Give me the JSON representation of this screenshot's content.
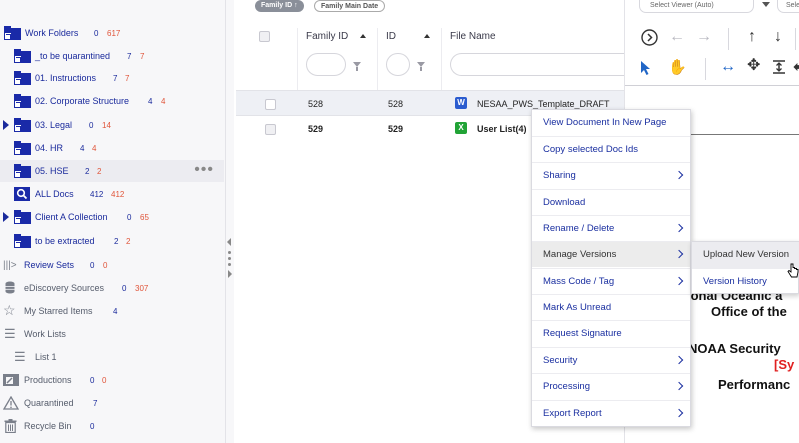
{
  "sidebar": {
    "items": [
      {
        "label": "Work Folders",
        "count_blue": "0",
        "count_red": "617"
      },
      {
        "label": "_to be quarantined",
        "count_blue": "7",
        "count_red": "7"
      },
      {
        "label": "01. Instructions",
        "count_blue": "7",
        "count_red": "7"
      },
      {
        "label": "02. Corporate Structure",
        "count_blue": "4",
        "count_red": "4"
      },
      {
        "label": "03. Legal",
        "count_blue": "0",
        "count_red": "14"
      },
      {
        "label": "04. HR",
        "count_blue": "4",
        "count_red": "4"
      },
      {
        "label": "05. HSE",
        "count_blue": "2",
        "count_red": "2"
      },
      {
        "label": "ALL Docs",
        "count_blue": "412",
        "count_red": "412"
      },
      {
        "label": "Client A Collection",
        "count_blue": "0",
        "count_red": "65"
      },
      {
        "label": "to be extracted",
        "count_blue": "2",
        "count_red": "2"
      }
    ],
    "sections": [
      {
        "label": "Review Sets",
        "count_blue": "0",
        "count_red": "0",
        "icon": "review-sets-icon"
      },
      {
        "label": "eDiscovery Sources",
        "count_blue": "0",
        "count_red": "307",
        "icon": "database-icon"
      },
      {
        "label": "My Starred Items",
        "count_blue": "4",
        "icon": "star-icon"
      },
      {
        "label": "Work Lists",
        "icon": "list-icon"
      },
      {
        "label": "List 1",
        "icon": "list-icon"
      },
      {
        "label": "Productions",
        "count_blue": "0",
        "count_red": "0",
        "icon": "productions-icon"
      },
      {
        "label": "Quarantined",
        "count_blue": "7",
        "icon": "warning-icon"
      },
      {
        "label": "Recycle Bin",
        "count_blue": "0",
        "icon": "trash-icon"
      }
    ]
  },
  "grid": {
    "sort_chips": [
      "Family ID ↑",
      "Family Main Date"
    ],
    "columns": [
      "Family ID",
      "ID",
      "File Name"
    ],
    "rows": [
      {
        "family_id": "528",
        "id": "528",
        "file_icon": "W",
        "file_name": "NESAA_PWS_Template_DRAFT"
      },
      {
        "family_id": "529",
        "id": "529",
        "file_icon": "X",
        "file_name": "User List(4)"
      }
    ]
  },
  "viewer": {
    "select_viewer": "Select Viewer (Auto)",
    "select_right": "Sele",
    "doc_lines": [
      "ional Oceanic a",
      "Office of the",
      "NOAA Security",
      "[Sy",
      "Performanc"
    ]
  },
  "context_menu": {
    "items": [
      {
        "label": "View Document In New Page",
        "submenu": false
      },
      {
        "label": "Copy selected Doc Ids",
        "submenu": false
      },
      {
        "label": "Sharing",
        "submenu": true
      },
      {
        "label": "Download",
        "submenu": false
      },
      {
        "label": "Rename / Delete",
        "submenu": true
      },
      {
        "label": "Manage Versions",
        "submenu": true
      },
      {
        "label": "Mass Code / Tag",
        "submenu": true
      },
      {
        "label": "Mark As Unread",
        "submenu": false
      },
      {
        "label": "Request Signature",
        "submenu": false
      },
      {
        "label": "Security",
        "submenu": true
      },
      {
        "label": "Processing",
        "submenu": true
      },
      {
        "label": "Export Report",
        "submenu": true
      }
    ]
  },
  "submenu": {
    "items": [
      "Upload New Version",
      "Version History"
    ]
  },
  "colors": {
    "folder": "#1a2aa8",
    "link_text": "#1a2fa0",
    "count_red": "#e0553a",
    "doc_red": "#e02020",
    "word_icon": "#2b5ccf",
    "excel_icon": "#21a336"
  }
}
